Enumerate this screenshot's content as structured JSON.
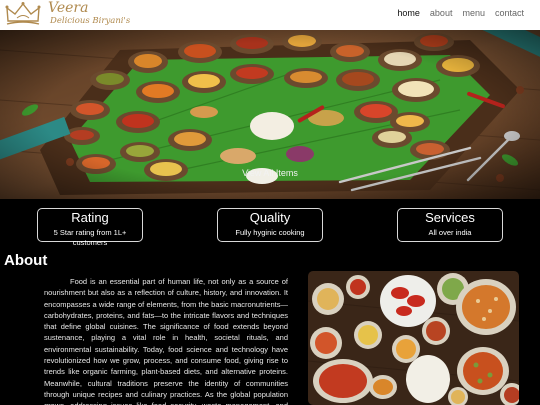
{
  "brand": {
    "name": "Veera",
    "tagline": "Delicious Biryani's"
  },
  "nav": {
    "items": [
      {
        "label": "home",
        "active": true
      },
      {
        "label": "about",
        "active": false
      },
      {
        "label": "menu",
        "active": false
      },
      {
        "label": "contact",
        "active": false
      }
    ]
  },
  "hero": {
    "caption": "View All Items"
  },
  "features": [
    {
      "title": "Rating",
      "text": "5 Star rating from 1L+ customers"
    },
    {
      "title": "Quality",
      "text": "Fully hyginic cooking"
    },
    {
      "title": "Services",
      "text": "All over india"
    }
  ],
  "about": {
    "title": "About",
    "body": "Food is an essential part of human life, not only as a source of nourishment but also as a reflection of culture, history, and innovation. It encompasses a wide range of elements, from the basic macronutrients—carbohydrates, proteins, and fats—to the intricate flavors and techniques that define global cuisines. The significance of food extends beyond sustenance, playing a vital role in health, societal rituals, and environmental sustainability. Today, food science and technology have revolutionized how we grow, process, and consume food, giving rise to trends like organic farming, plant-based diets, and alternative proteins. Meanwhile, cultural traditions preserve the identity of communities through unique recipes and culinary practices. As the global population grows, addressing issues like food security, waste management, and sustainable farming has become increasingly critical."
  },
  "colors": {
    "brand_gold": "#b08a4e",
    "page_background": "#000000",
    "navbar_background": "#ffffff"
  }
}
